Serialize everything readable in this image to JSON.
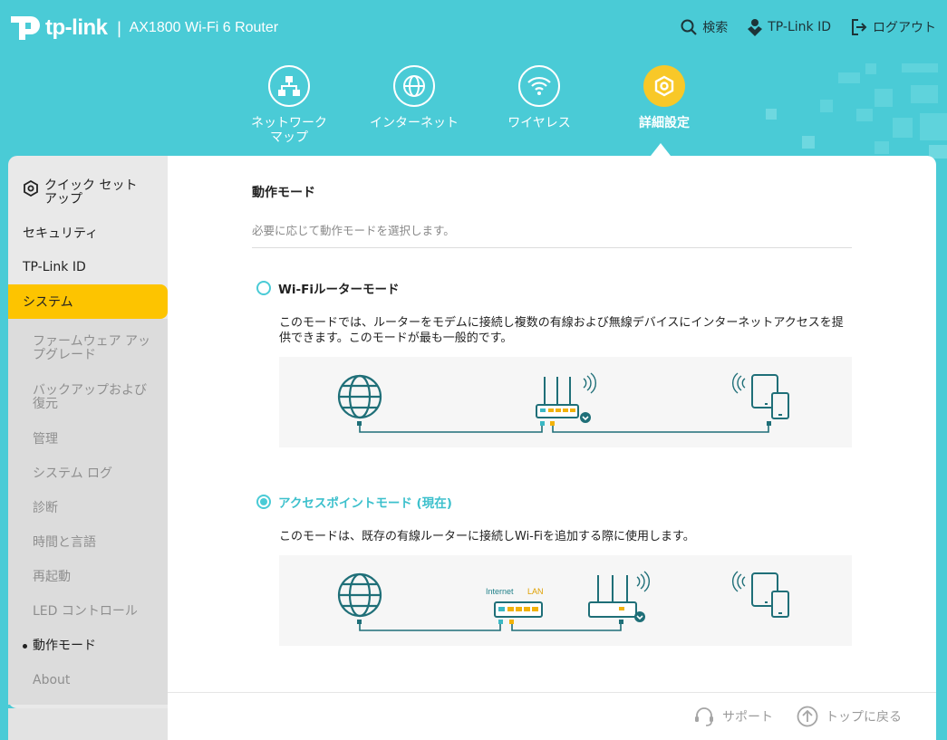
{
  "header": {
    "brand": "tp-link",
    "separator": "|",
    "model": "AX1800 Wi-Fi 6 Router",
    "links": [
      {
        "label": "検索",
        "icon": "search-icon"
      },
      {
        "label": "TP-Link ID",
        "icon": "tplink-id-icon"
      },
      {
        "label": "ログアウト",
        "icon": "logout-icon"
      }
    ],
    "tabs": [
      {
        "label": "ネットワーク\nマップ",
        "icon": "network-map-icon"
      },
      {
        "label": "インターネット",
        "icon": "globe-icon"
      },
      {
        "label": "ワイヤレス",
        "icon": "wifi-icon"
      },
      {
        "label": "詳細設定",
        "icon": "advanced-gear-icon",
        "active": true
      }
    ]
  },
  "sidebar": {
    "quick_setup": "クイック セット\nアップ",
    "security": "セキュリティ",
    "tplink_id": "TP-Link ID",
    "system": "システム",
    "sub_items": [
      "ファームウェア アップグレード",
      "バックアップおよび復元",
      "管理",
      "システム ログ",
      "診断",
      "時間と言語",
      "再起動",
      "LED コントロール",
      "動作モード",
      "About"
    ],
    "current_sub": "動作モード"
  },
  "main": {
    "title": "動作モード",
    "description": "必要に応じて動作モードを選択します。",
    "modes": [
      {
        "title": "Wi-Fiルーターモード",
        "selected": false,
        "description": "このモードでは、ルーターをモデムに接続し複数の有線および無線デバイスにインターネットアクセスを提供できます。このモードが最も一般的です。"
      },
      {
        "title": "アクセスポイントモード (現在)",
        "selected": true,
        "description": "このモードは、既存の有線ルーターに接続しWi-Fiを追加する際に使用します。",
        "port_labels": {
          "internet": "Internet",
          "lan": "LAN"
        }
      }
    ]
  },
  "footer": {
    "support": "サポート",
    "back_to_top": "トップに戻る"
  },
  "colors": {
    "header_teal": "#4acbd6",
    "accent_yellow": "#fdc400",
    "diagram_teal": "#1f6f78"
  }
}
